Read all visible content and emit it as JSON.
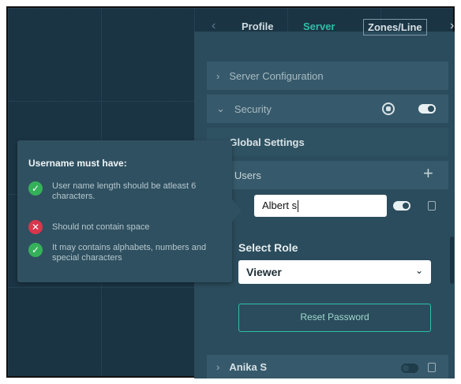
{
  "tabs": {
    "items": [
      {
        "label": "Profile"
      },
      {
        "label": "Server"
      },
      {
        "label": "Zones/Line"
      }
    ]
  },
  "sections": {
    "server_configuration": "Server Configuration",
    "security": "Security",
    "global_settings": "Global Settings",
    "users": "Users"
  },
  "user_edit": {
    "username_value": "Albert s",
    "select_role_label": "Select Role",
    "role_value": "Viewer",
    "reset_password_label": "Reset Password"
  },
  "user_list": [
    {
      "name": "Anika S"
    }
  ],
  "tooltip": {
    "title": "Username must have:",
    "rules": [
      {
        "text": "User name length should be atleast 6 characters.",
        "status": "pass"
      },
      {
        "text": "Should not contain space",
        "status": "fail"
      },
      {
        "text": "It may contains alphabets, numbers and special characters",
        "status": "pass"
      }
    ]
  },
  "colors": {
    "accent": "#2fbfa6",
    "background": "#1b3444",
    "panel": "#2b4c5c",
    "pass": "#35b05a",
    "fail": "#d9364c"
  },
  "icons": {
    "tab_prev": "chevron-left-icon",
    "tab_next": "chevron-right-icon",
    "add_user": "plus-icon",
    "security_status": "shield-icon",
    "user_delete": "trash-icon"
  }
}
